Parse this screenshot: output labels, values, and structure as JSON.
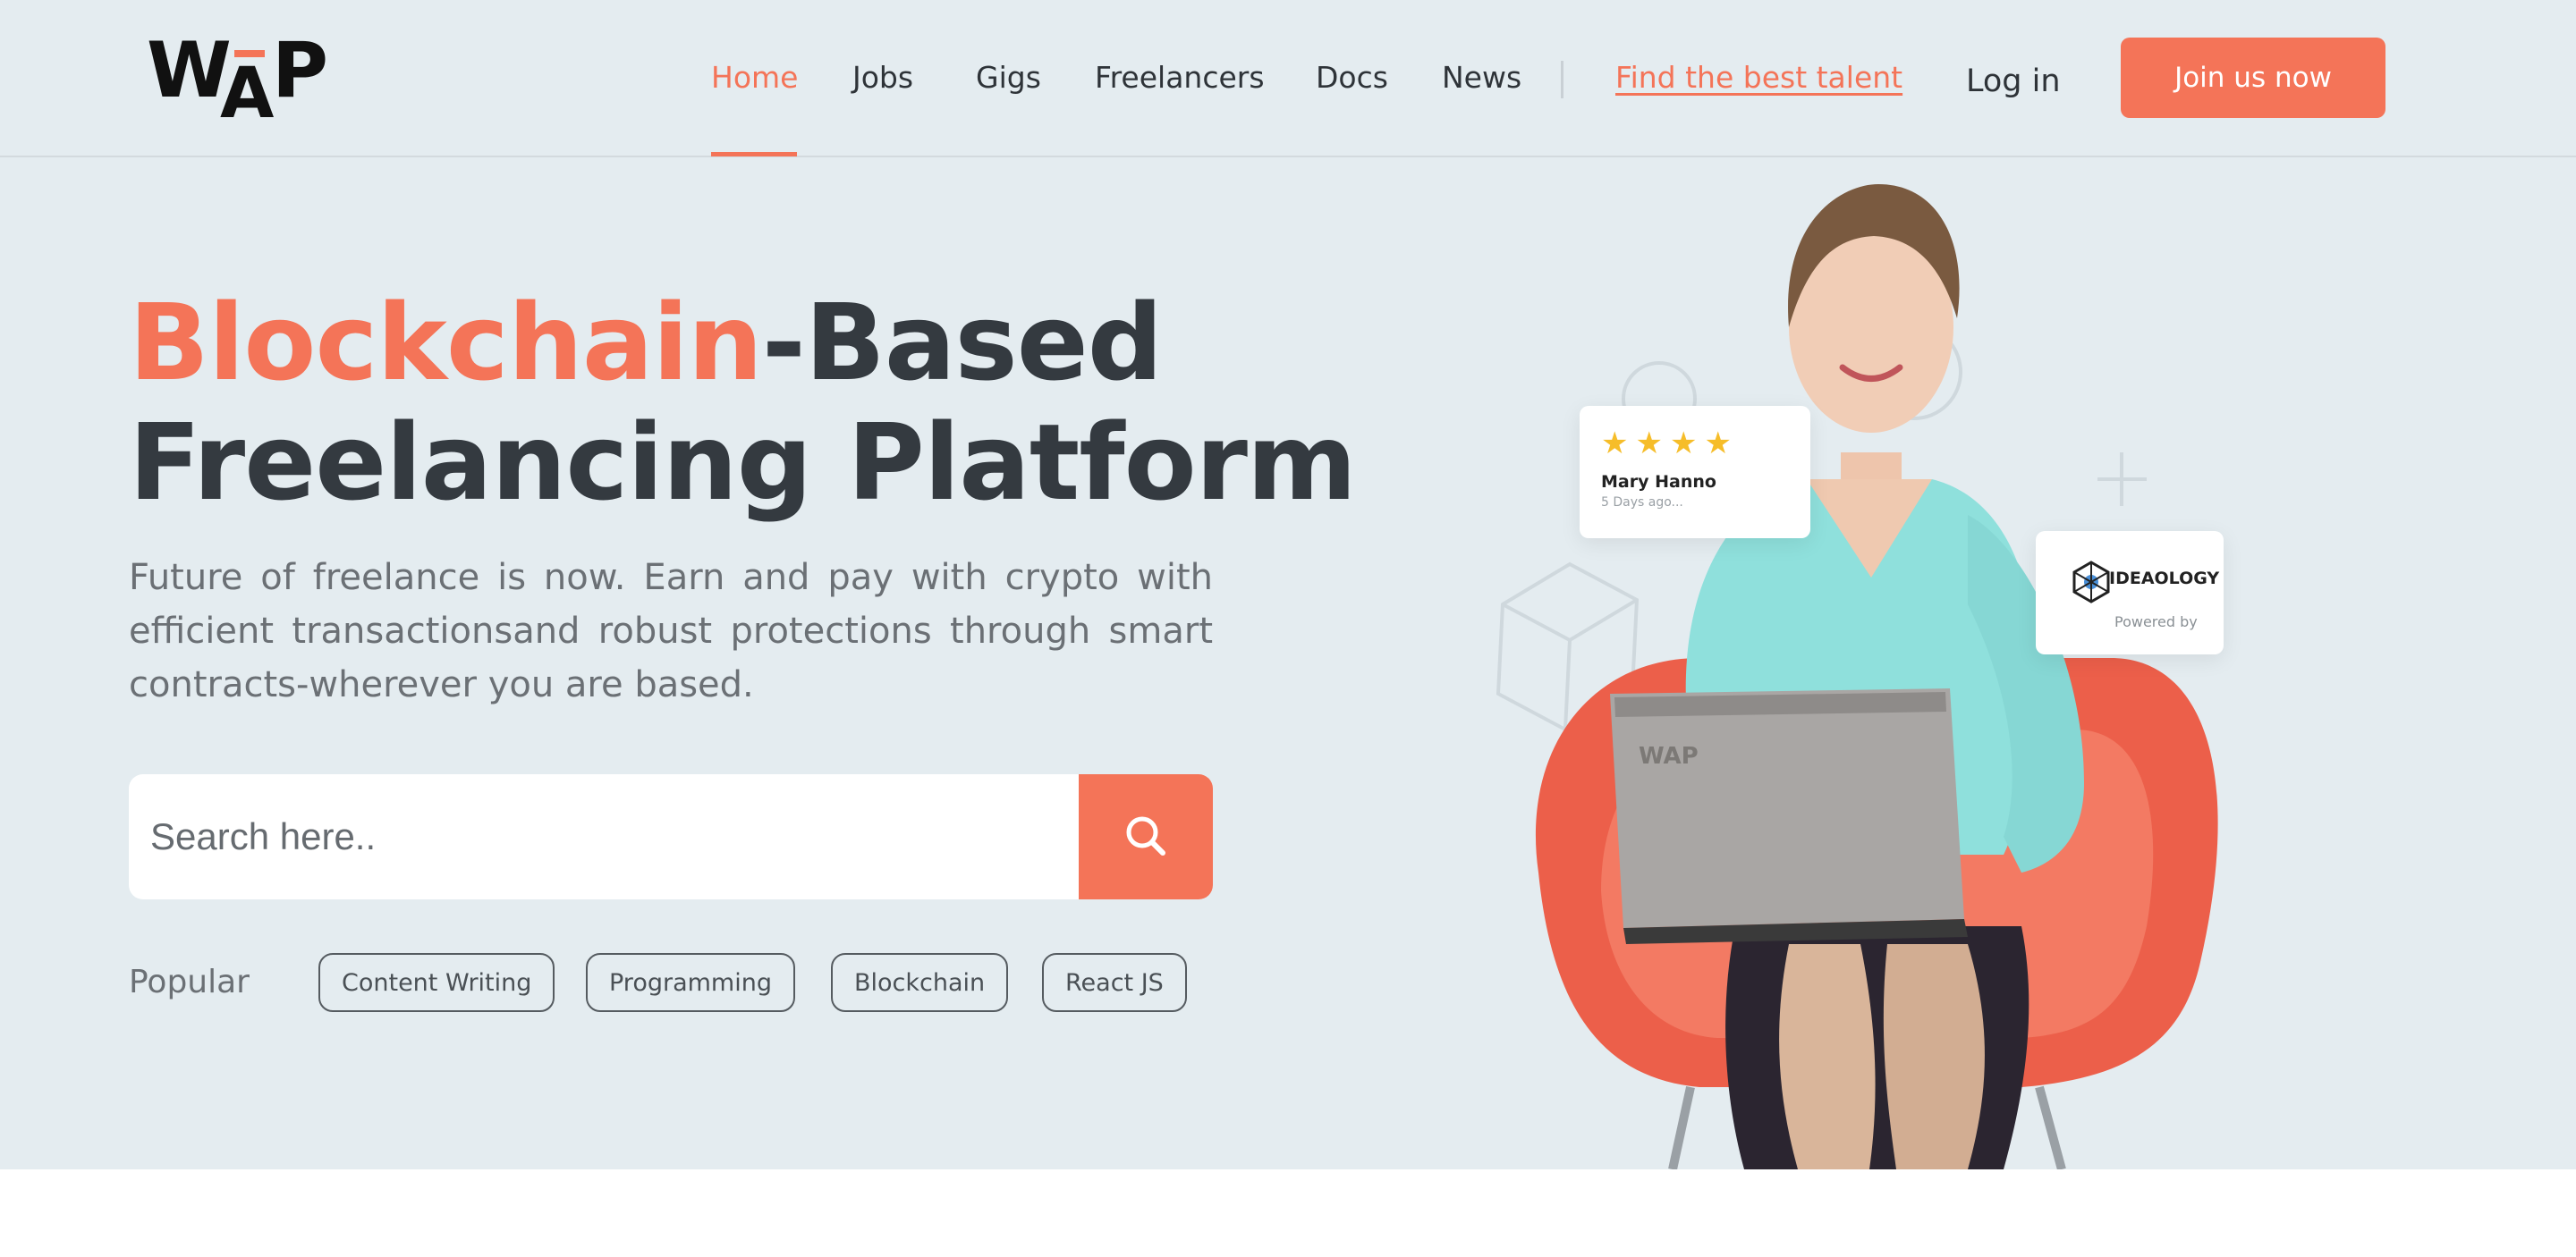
{
  "header": {
    "logo_text": "WAP",
    "nav": [
      {
        "label": "Home",
        "active": true
      },
      {
        "label": "Jobs",
        "active": false
      },
      {
        "label": "Gigs",
        "active": false
      },
      {
        "label": "Freelancers",
        "active": false
      },
      {
        "label": "Docs",
        "active": false
      },
      {
        "label": "News",
        "active": false
      }
    ],
    "talent_link": "Find the best talent",
    "login": "Log in",
    "join": "Join us now"
  },
  "hero": {
    "headline_accent": "Blockchain",
    "headline_rest": "-Based",
    "headline_line2": "Freelancing Platform",
    "subtext": "Future of freelance is now. Earn and pay with crypto with efficient transactionsand robust protections through smart contracts-wherever you are based.",
    "search_placeholder": "Search here..",
    "popular_label": "Popular",
    "popular_tags": [
      "Content Writing",
      "Programming",
      "Blockchain",
      "React JS"
    ]
  },
  "illustration": {
    "review_stars": "★★★★",
    "reviewer_name": "Mary Hanno",
    "review_time": "5 Days ago...",
    "laptop_logo": "WAP",
    "brand_name": "IDEAOLOGY",
    "brand_sub": "Powered by"
  },
  "colors": {
    "accent": "#f47458",
    "hero_bg": "#e4ecf0",
    "heading": "#343a40",
    "body_text": "#6b7075",
    "star": "#f6bd29"
  }
}
